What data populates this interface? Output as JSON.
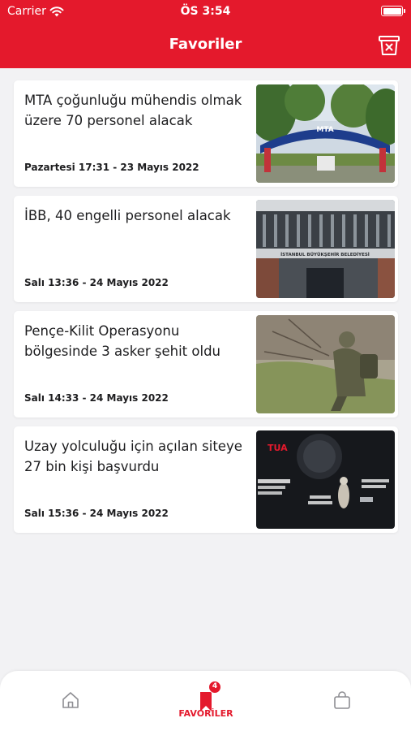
{
  "status_bar": {
    "carrier": "Carrier",
    "time": "ÖS 3:54"
  },
  "header": {
    "title": "Favoriler"
  },
  "articles": [
    {
      "title": "MTA çoğunluğu mühendis olmak üzere 70 personel alacak",
      "date": "Pazartesi 17:31 - 23 Mayıs 2022",
      "image_sign": "MTA"
    },
    {
      "title": "İBB, 40 engelli personel alacak",
      "date": "Salı 13:36 - 24 Mayıs 2022",
      "image_sign": "İSTANBUL BÜYÜKŞEHİR BELEDİYESİ"
    },
    {
      "title": "Pençe-Kilit Operasyonu bölgesinde 3 asker şehit oldu",
      "date": "Salı 14:33 - 24 Mayıs 2022"
    },
    {
      "title": "Uzay yolculuğu için açılan siteye 27 bin kişi başvurdu",
      "date": "Salı 15:36 - 24 Mayıs 2022",
      "image_sign": "TUA"
    }
  ],
  "tabbar": {
    "favorites_label": "FAVORİLER",
    "favorites_count": "4"
  },
  "colors": {
    "accent": "#e4192c"
  },
  "icons": [
    "wifi-icon",
    "battery-icon",
    "trash-icon",
    "home-icon",
    "bookmark-icon",
    "shopping-bag-icon"
  ]
}
